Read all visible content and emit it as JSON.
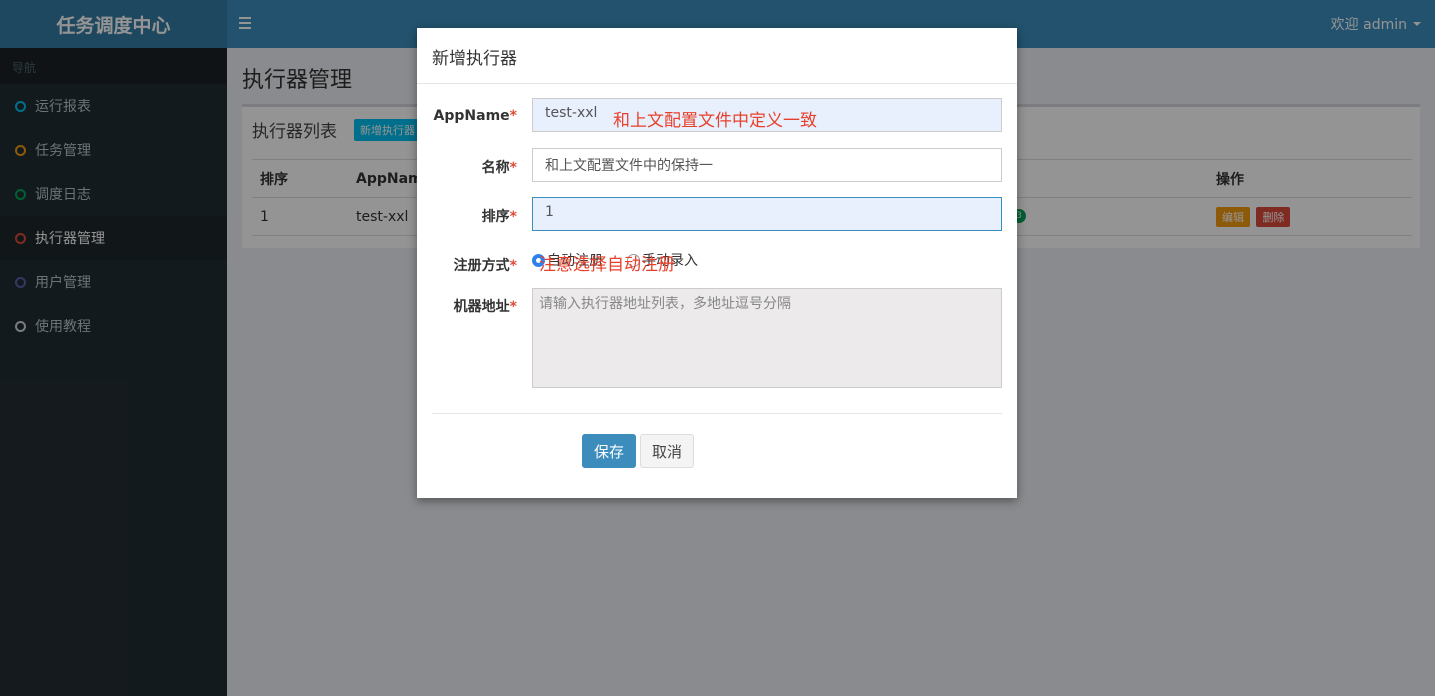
{
  "header": {
    "logo": "任务调度中心",
    "user_label": "欢迎 admin",
    "colors": {
      "topbar": "#3c8dbc",
      "logo_bg": "#357ca5"
    }
  },
  "sidebar": {
    "section_label": "导航",
    "items": [
      {
        "label": "运行报表",
        "dot_color": "#00c0ef"
      },
      {
        "label": "任务管理",
        "dot_color": "#f39c12"
      },
      {
        "label": "调度日志",
        "dot_color": "#00a65a"
      },
      {
        "label": "执行器管理",
        "dot_color": "#dd4b39"
      },
      {
        "label": "用户管理",
        "dot_color": "#605ca8"
      },
      {
        "label": "使用教程",
        "dot_color": "#d2d6de"
      }
    ]
  },
  "page": {
    "title": "执行器管理",
    "box_title": "执行器列表",
    "add_button": "新增执行器",
    "table": {
      "headers": [
        "排序",
        "AppName",
        "操作"
      ],
      "rows": [
        {
          "order": "1",
          "appname": "test-xxl"
        }
      ],
      "status_badge": "3",
      "edit_label": "编辑",
      "delete_label": "删除"
    }
  },
  "modal": {
    "title": "新增执行器",
    "fields": {
      "appname": {
        "label": "AppName",
        "value": "test-xxl",
        "annotation": "和上文配置文件中定义一致"
      },
      "name": {
        "label": "名称",
        "value": "和上文配置文件中的保持一"
      },
      "order": {
        "label": "排序",
        "value": "1"
      },
      "register": {
        "label": "注册方式",
        "option_auto": "自动注册",
        "option_manual": "手动录入",
        "annotation": "注意选择自动注册"
      },
      "address": {
        "label": "机器地址",
        "placeholder": "请输入执行器地址列表，多地址逗号分隔"
      }
    },
    "save_label": "保存",
    "cancel_label": "取消"
  }
}
